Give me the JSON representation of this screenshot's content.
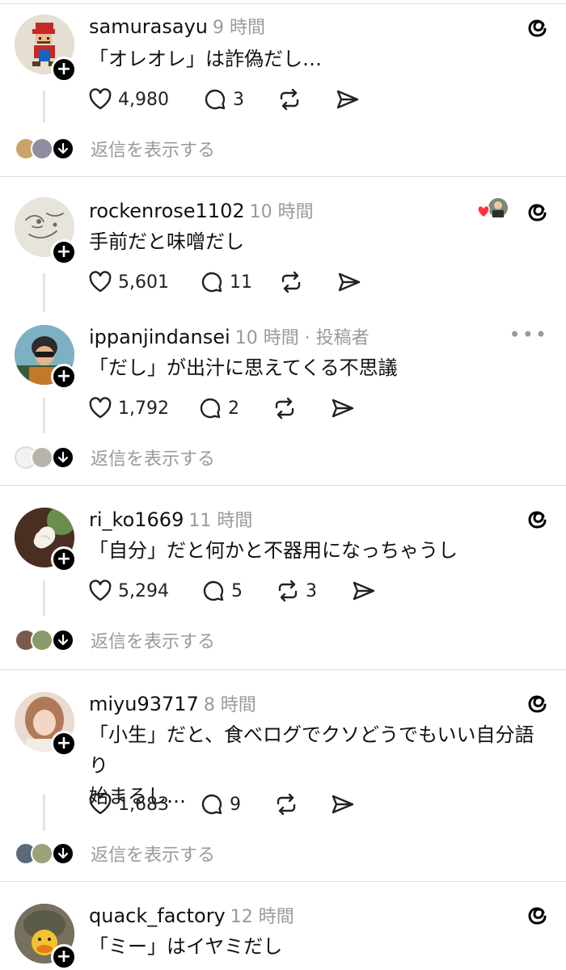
{
  "replies_label": "返信を表示する",
  "posts": [
    {
      "username": "samurasayu",
      "time": "9 時間",
      "text": "「オレオレ」は詐偽だし…",
      "likes": "4,980",
      "comments": "3",
      "reposts": ""
    },
    {
      "username": "rockenrose1102",
      "time": "10 時間",
      "text": "手前だと味噌だし",
      "likes": "5,601",
      "comments": "11",
      "reposts": ""
    },
    {
      "username": "ippanjindansei",
      "time": "10 時間 · 投稿者",
      "text": "「だし」が出汁に思えてくる不思議",
      "likes": "1,792",
      "comments": "2",
      "reposts": ""
    },
    {
      "username": "ri_ko1669",
      "time": "11 時間",
      "text": "「自分」だと何かと不器用になっちゃうし",
      "likes": "5,294",
      "comments": "5",
      "reposts": "3"
    },
    {
      "username": "miyu93717",
      "time": "8 時間",
      "text_line1": "「小生」だと、食べログでクソどうでもいい自分語り",
      "text_line2": "始まるし…",
      "likes": "1,683",
      "comments": "9",
      "reposts": ""
    },
    {
      "username": "quack_factory",
      "time": "12 時間",
      "text": "「ミー」はイヤミだし",
      "likes": "",
      "comments": "",
      "reposts": ""
    }
  ],
  "more_icon": "•••",
  "colors": {
    "accent": "#000000",
    "muted": "#9a9a9a",
    "heart": "#ff3040",
    "divider": "#dcdcdc"
  }
}
